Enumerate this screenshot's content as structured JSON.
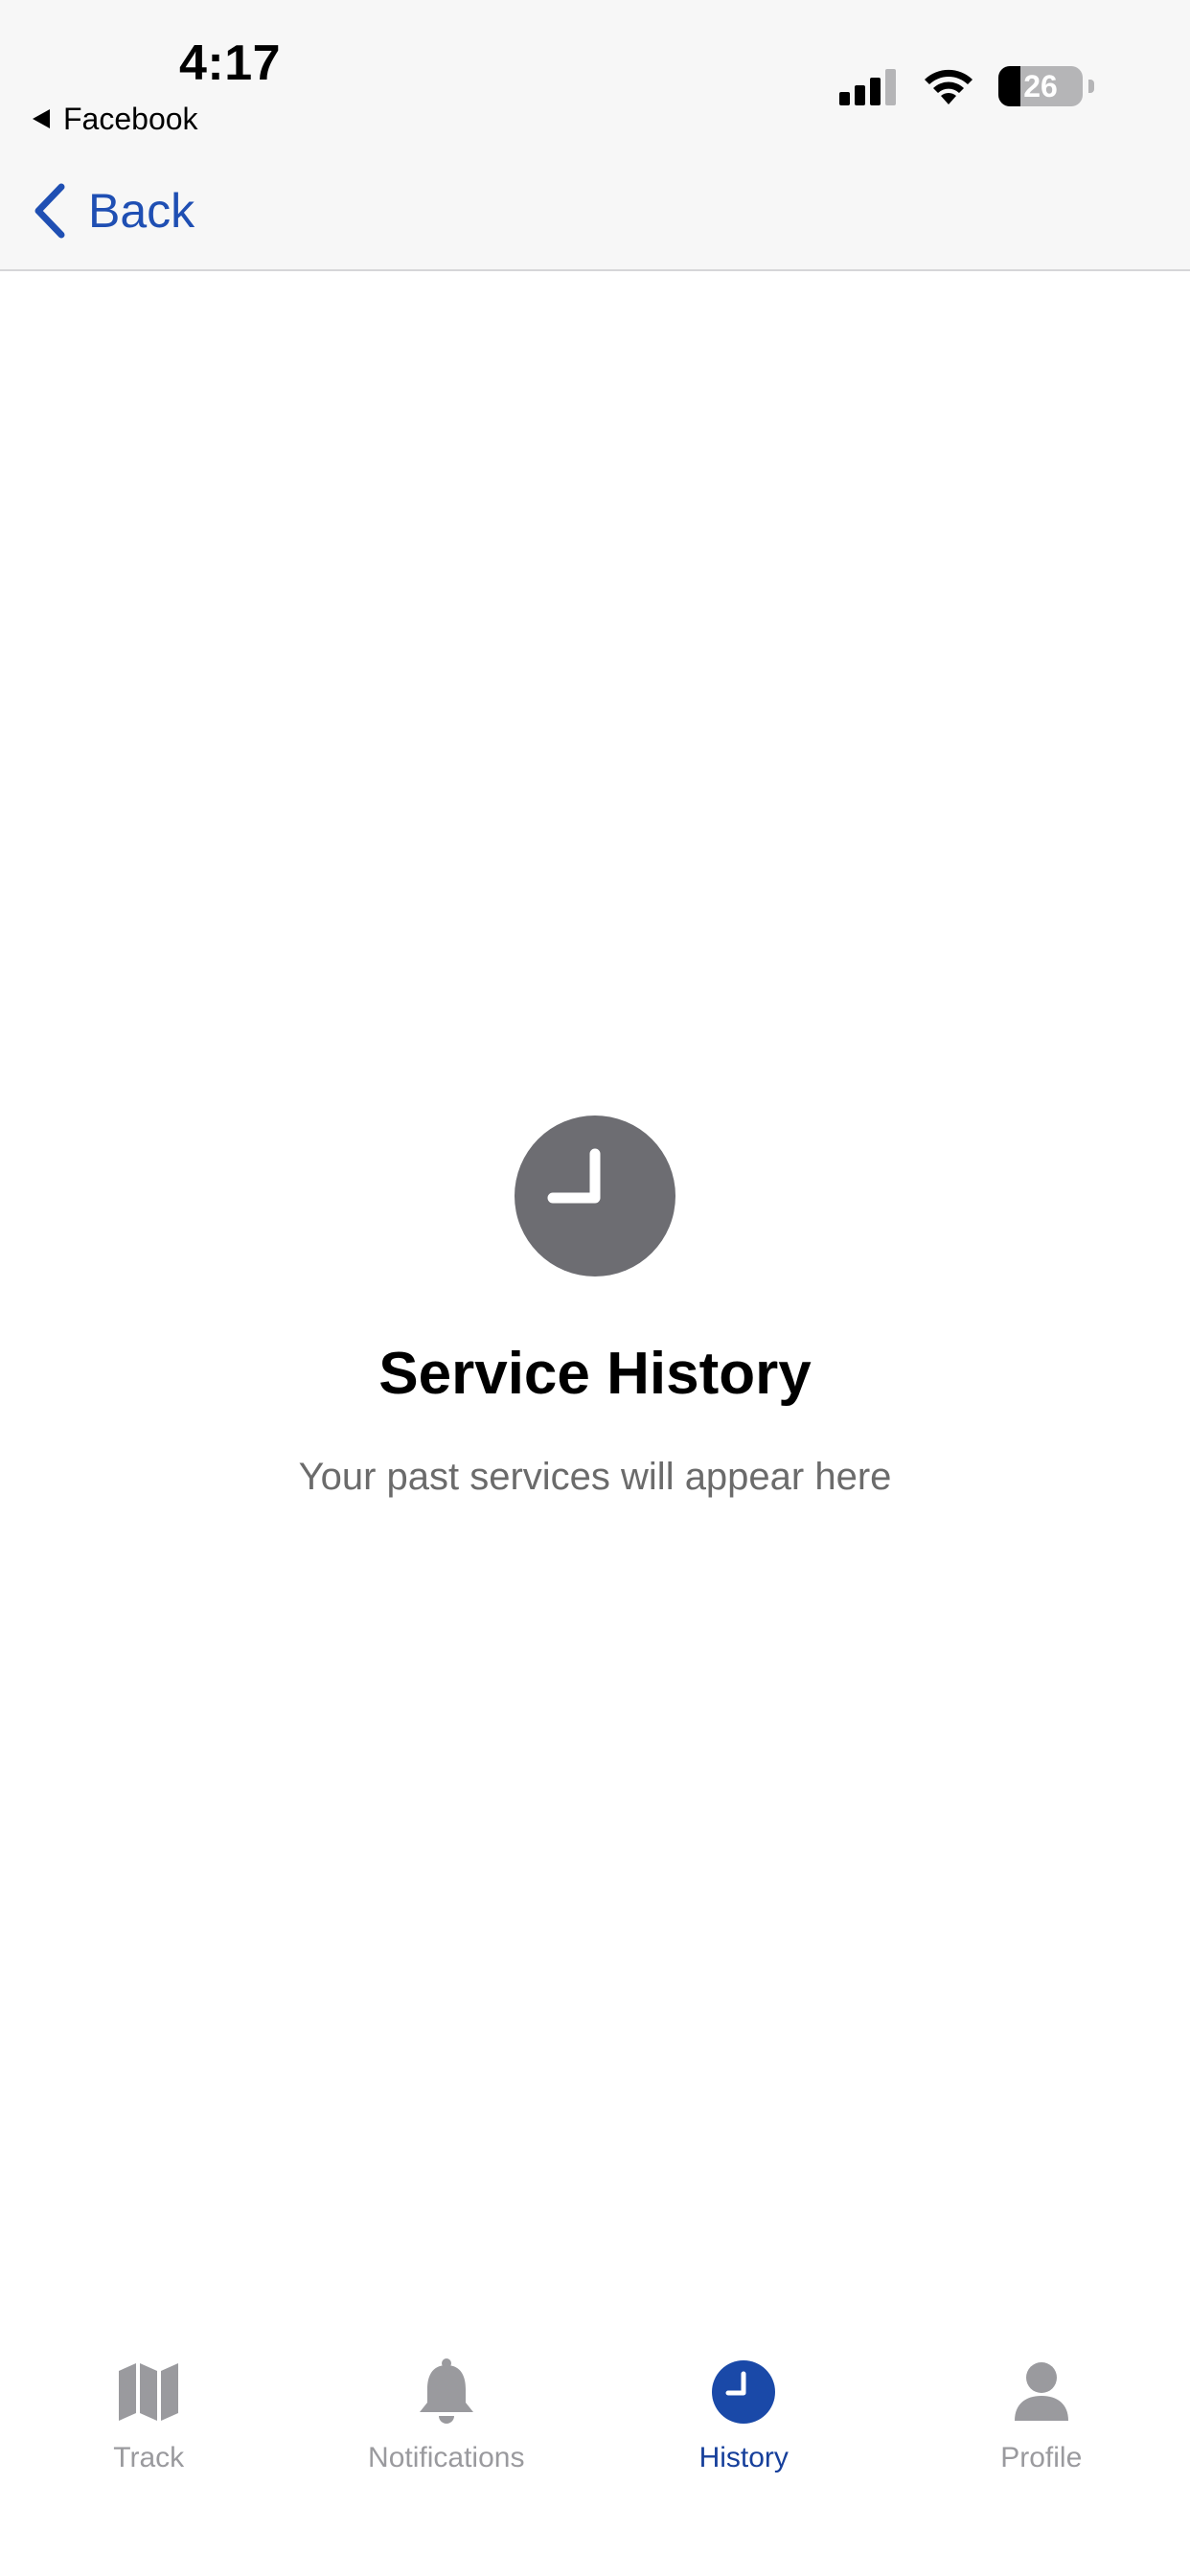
{
  "status_bar": {
    "time": "4:17",
    "back_app": "Facebook",
    "battery_level": "26"
  },
  "nav": {
    "back_label": "Back"
  },
  "empty_state": {
    "title": "Service History",
    "subtitle": "Your past services will appear here"
  },
  "tabs": [
    {
      "label": "Track",
      "icon": "map-icon",
      "active": false
    },
    {
      "label": "Notifications",
      "icon": "bell-icon",
      "active": false
    },
    {
      "label": "History",
      "icon": "clock-icon",
      "active": true
    },
    {
      "label": "Profile",
      "icon": "person-icon",
      "active": false
    }
  ],
  "colors": {
    "accent": "#1f4fb3",
    "active_tab": "#163f9b",
    "inactive_tab": "#9a9a9e",
    "empty_icon_bg": "#6d6d72"
  }
}
